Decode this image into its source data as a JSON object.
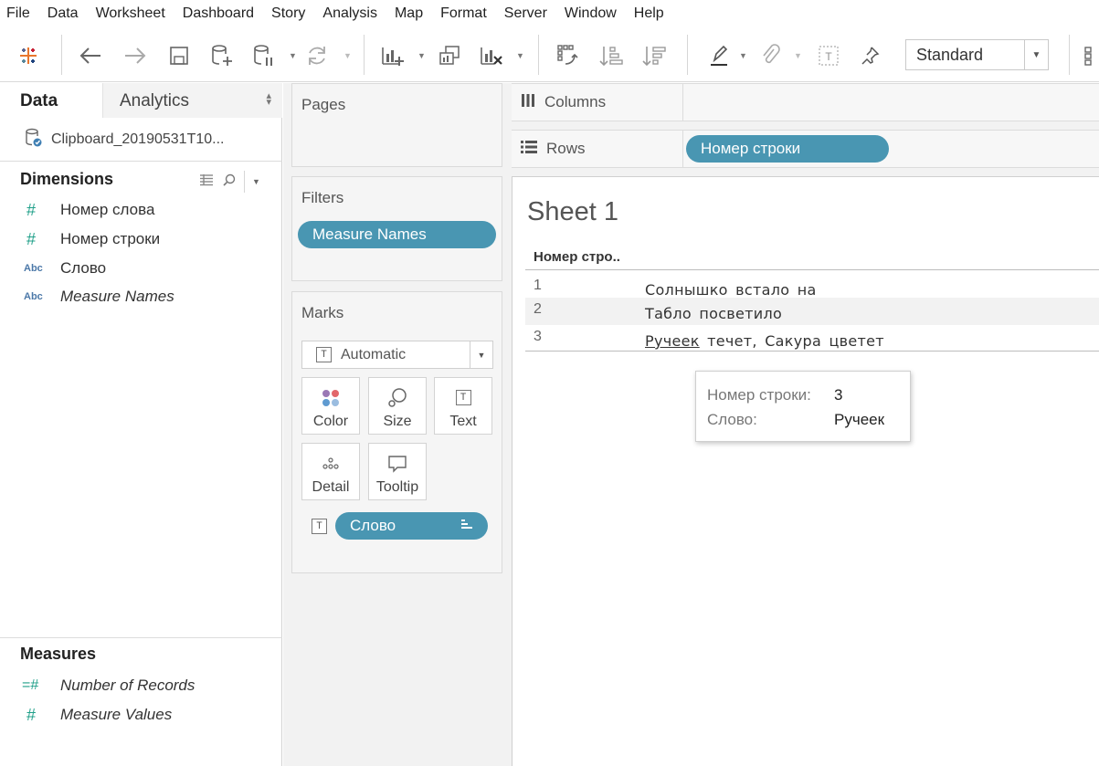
{
  "menu": [
    "File",
    "Data",
    "Worksheet",
    "Dashboard",
    "Story",
    "Analysis",
    "Map",
    "Format",
    "Server",
    "Window",
    "Help"
  ],
  "toolbar": {
    "fit_value": "Standard",
    "buttons": [
      "tableau-logo-icon",
      "undo-icon",
      "redo-icon",
      "save-icon",
      "new-datasource-icon",
      "pause-updates-icon",
      "refresh-icon",
      "new-worksheet-icon",
      "duplicate-sheet-icon",
      "clear-sheet-icon",
      "swap-rows-columns-icon",
      "sort-ascending-icon",
      "sort-descending-icon",
      "highlight-icon",
      "group-members-icon",
      "show-mark-labels-icon",
      "fix-axes-icon",
      "show-me-icon"
    ]
  },
  "data_pane": {
    "tab_data": "Data",
    "tab_analytics": "Analytics",
    "datasource": "Clipboard_20190531T10...",
    "dimensions_title": "Dimensions",
    "dimensions": [
      {
        "type": "number",
        "icon": "#",
        "label": "Номер слова",
        "italic": false
      },
      {
        "type": "number",
        "icon": "#",
        "label": "Номер строки",
        "italic": false
      },
      {
        "type": "string",
        "icon": "Abc",
        "label": "Слово",
        "italic": false
      },
      {
        "type": "string",
        "icon": "Abc",
        "label": "Measure Names",
        "italic": true
      }
    ],
    "measures_title": "Measures",
    "measures": [
      {
        "type": "number-calc",
        "icon": "=#",
        "label": "Number of Records",
        "italic": true
      },
      {
        "type": "number",
        "icon": "#",
        "label": "Measure Values",
        "italic": true
      }
    ]
  },
  "shelves": {
    "pages_title": "Pages",
    "filters_title": "Filters",
    "filter_pill": "Measure Names",
    "marks_title": "Marks",
    "mark_type": "Automatic",
    "mark_buttons": [
      "Color",
      "Size",
      "Text",
      "Detail",
      "Tooltip"
    ],
    "text_pill": "Слово",
    "columns_label": "Columns",
    "rows_label": "Rows",
    "rows_pill": "Номер строки"
  },
  "view": {
    "sheet_title": "Sheet 1",
    "column_header": "Номер стро..",
    "rows": [
      {
        "num": "1",
        "words": [
          "Солнышко",
          "встало",
          "на"
        ]
      },
      {
        "num": "2",
        "words": [
          "Табло",
          "посветило"
        ]
      },
      {
        "num": "3",
        "words": [
          "Ручеек",
          "течет,",
          "Сакура",
          "цветет"
        ]
      }
    ]
  },
  "tooltip": {
    "row_key": "Номер строки:",
    "row_value": "3",
    "word_key": "Слово:",
    "word_value": "Ручеек"
  },
  "colors": {
    "pill": "#4996b2",
    "number_field": "#21a08a",
    "string_field": "#4b78a8",
    "pane_background": "#f2f2f2"
  }
}
